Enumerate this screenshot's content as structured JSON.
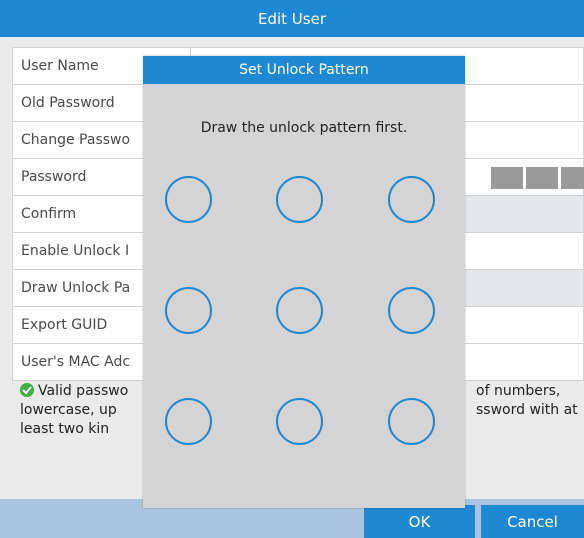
{
  "window": {
    "title": "Edit User"
  },
  "form": {
    "rows": [
      {
        "label": "User Name"
      },
      {
        "label": "Old Password"
      },
      {
        "label": "Change Passwo"
      },
      {
        "label": "Password"
      },
      {
        "label": "Confirm"
      },
      {
        "label": "Enable Unlock I"
      },
      {
        "label": "Draw Unlock Pa"
      },
      {
        "label": "Export GUID"
      },
      {
        "label": "User's MAC Adc"
      }
    ]
  },
  "hint": {
    "line1_left": "Valid passwo",
    "line2_left": "lowercase, up",
    "line3_left": "least two kin",
    "line1_right": "of numbers,",
    "line2_right": "ssword with at"
  },
  "buttons": {
    "ok": "OK",
    "cancel": "Cancel"
  },
  "dialog": {
    "title": "Set Unlock Pattern",
    "instruction": "Draw the unlock pattern first."
  },
  "colors": {
    "accent": "#1e88d2",
    "footer": "#a9c4dc",
    "valid": "#3fae49"
  }
}
